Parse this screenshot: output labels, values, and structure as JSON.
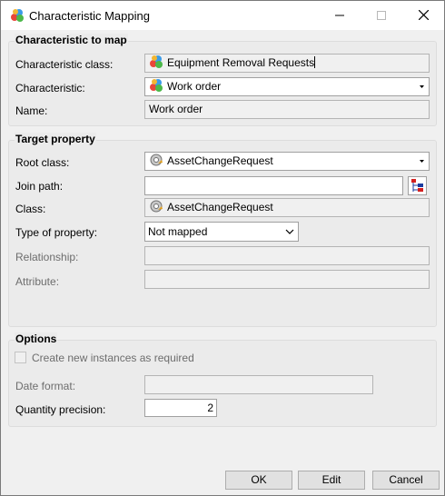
{
  "window": {
    "title": "Characteristic Mapping",
    "icon": "characteristic-mapping-icon"
  },
  "characteristic_section": {
    "title": "Characteristic to map",
    "class_label": "Characteristic class:",
    "class_value": "Equipment Removal Requests",
    "characteristic_label": "Characteristic:",
    "characteristic_value": "Work order",
    "name_label": "Name:",
    "name_value": "Work order"
  },
  "target_section": {
    "title": "Target property",
    "root_class_label": "Root class:",
    "root_class_value": "AssetChangeRequest",
    "join_path_label": "Join path:",
    "join_path_value": "",
    "class_label": "Class:",
    "class_value": "AssetChangeRequest",
    "type_label": "Type of property:",
    "type_value": "Not mapped",
    "relationship_label": "Relationship:",
    "relationship_value": "",
    "attribute_label": "Attribute:",
    "attribute_value": ""
  },
  "options_section": {
    "title": "Options",
    "create_instances_label": "Create new instances as required",
    "create_instances_checked": false,
    "date_format_label": "Date format:",
    "date_format_value": "",
    "quantity_precision_label": "Quantity precision:",
    "quantity_precision_value": "2"
  },
  "buttons": {
    "ok": "OK",
    "edit": "Edit",
    "cancel": "Cancel"
  }
}
